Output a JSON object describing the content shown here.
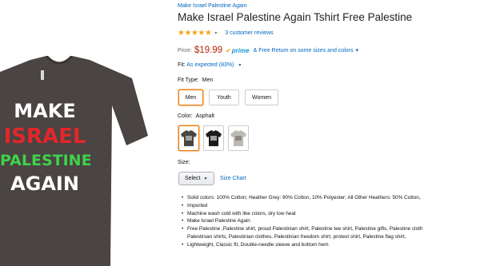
{
  "breadcrumb": "Make Israel Palestine Again",
  "title": "Make Israel Palestine Again Tshirt Free Palestine",
  "rating": {
    "stars_text": "★★★★★",
    "reviews_link": "3 customer reviews",
    "chevron": "▾"
  },
  "price": {
    "label": "Price:",
    "value": "$19.99",
    "prime_check": "✔",
    "prime_label": "prime",
    "free_return": "& Free Return on some sizes and colors",
    "return_icon": "▾"
  },
  "fit": {
    "label": "Fit:",
    "value": "As expected (83%)",
    "chevron": "▾"
  },
  "fit_type": {
    "label": "Fit Type:",
    "value": "Men",
    "options": [
      "Men",
      "Youth",
      "Women"
    ],
    "selected": "Men"
  },
  "color": {
    "label": "Color:",
    "value": "Asphalt",
    "swatches": [
      {
        "name": "asphalt",
        "hex": "#4a4442"
      },
      {
        "name": "black",
        "hex": "#1b1b1b"
      },
      {
        "name": "grey",
        "hex": "#bdbab3"
      }
    ]
  },
  "size": {
    "label": "Size:",
    "select_value": "Select",
    "size_chart_link": "Size Chart"
  },
  "features": [
    "Solid colors: 100% Cotton; Heather Grey: 90% Cotton, 10% Polyester; All Other Heathers: 50% Cotton,",
    "Imported",
    "Machine wash cold with like colors, dry low heat",
    "Make Israel Palestine Again",
    "Free Palestine ,Palestine shirt, proud Palestinian shirt, Palestine tee shirt, Palestine gifts, Palestine cloth",
    "Palestinian shirts, Palestinian clothes, Palestinian freedom shirt, protest shirt, Palestine flag shirt,",
    "Lightweight, Classic fit, Double-needle sleeve and bottom hem"
  ],
  "shirt_print": {
    "line1": "MAKE",
    "line2": "ISRAEL",
    "line3": "PALESTINE",
    "line4": "AGAIN"
  },
  "colors": {
    "link": "#0066c0",
    "price": "#b12704",
    "star": "#f0a61a",
    "selected_border": "#e77600",
    "shirt": "#4a4442",
    "print_red": "#e3262b",
    "print_green": "#3fd24a"
  }
}
